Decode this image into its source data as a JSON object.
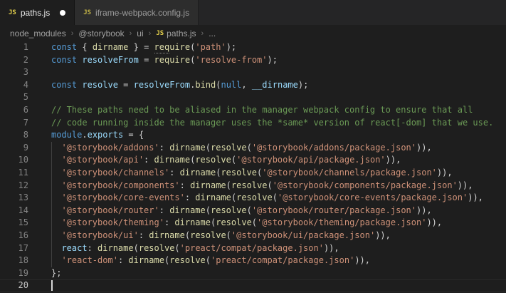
{
  "icons": {
    "js_badge": "JS",
    "modified_dot": "modified-dot"
  },
  "colors": {
    "editor_bg": "#1e1e1e",
    "tabstrip_bg": "#252526",
    "inactive_tab_bg": "#2d2d2d",
    "keyword": "#569cd6",
    "variable": "#9cdcfe",
    "function": "#dcdcaa",
    "string": "#ce9178",
    "comment": "#6a9955",
    "punctuation": "#d4d4d4",
    "js_icon": "#e8d44d",
    "line_number": "#858585"
  },
  "tabs": [
    {
      "label": "paths.js",
      "active": true,
      "modified": true
    },
    {
      "label": "iframe-webpack.config.js",
      "active": false,
      "modified": false
    }
  ],
  "breadcrumb": {
    "separator": "›",
    "items": [
      {
        "label": "node_modules",
        "icon": false
      },
      {
        "label": "@storybook",
        "icon": false
      },
      {
        "label": "ui",
        "icon": false
      },
      {
        "label": "paths.js",
        "icon": true
      },
      {
        "label": "...",
        "icon": false
      }
    ]
  },
  "editor": {
    "cursor_line": 20,
    "lines": [
      {
        "n": 1,
        "guide": false,
        "tokens": [
          [
            "kw",
            "const"
          ],
          [
            "pun",
            " { "
          ],
          [
            "fn",
            "dirname"
          ],
          [
            "pun",
            " } = "
          ],
          [
            "fnh",
            "req"
          ],
          [
            "fn",
            "uire"
          ],
          [
            "pun",
            "("
          ],
          [
            "str",
            "'path'"
          ],
          [
            "pun",
            ");"
          ]
        ]
      },
      {
        "n": 2,
        "guide": false,
        "tokens": [
          [
            "kw",
            "const"
          ],
          [
            "pun",
            " "
          ],
          [
            "var",
            "resolveFrom"
          ],
          [
            "pun",
            " = "
          ],
          [
            "fn",
            "require"
          ],
          [
            "pun",
            "("
          ],
          [
            "str",
            "'resolve-from'"
          ],
          [
            "pun",
            ");"
          ]
        ]
      },
      {
        "n": 3,
        "guide": false,
        "tokens": []
      },
      {
        "n": 4,
        "guide": false,
        "tokens": [
          [
            "kw",
            "const"
          ],
          [
            "pun",
            " "
          ],
          [
            "var",
            "resolve"
          ],
          [
            "pun",
            " = "
          ],
          [
            "var",
            "resolveFrom"
          ],
          [
            "pun",
            "."
          ],
          [
            "fn",
            "bind"
          ],
          [
            "pun",
            "("
          ],
          [
            "kw",
            "null"
          ],
          [
            "pun",
            ", "
          ],
          [
            "var",
            "__dirname"
          ],
          [
            "pun",
            ");"
          ]
        ]
      },
      {
        "n": 5,
        "guide": false,
        "tokens": []
      },
      {
        "n": 6,
        "guide": false,
        "tokens": [
          [
            "cmt",
            "// These paths need to be aliased in the manager webpack config to ensure that all"
          ]
        ]
      },
      {
        "n": 7,
        "guide": false,
        "tokens": [
          [
            "cmt",
            "// code running inside the manager uses the *same* version of react[-dom] that we use."
          ]
        ]
      },
      {
        "n": 8,
        "guide": false,
        "tokens": [
          [
            "kw",
            "module"
          ],
          [
            "pun",
            "."
          ],
          [
            "var",
            "exports"
          ],
          [
            "pun",
            " = {"
          ]
        ]
      },
      {
        "n": 9,
        "guide": true,
        "tokens": [
          [
            "pun",
            "  "
          ],
          [
            "str",
            "'@storybook/addons'"
          ],
          [
            "pun",
            ": "
          ],
          [
            "fn",
            "dirname"
          ],
          [
            "pun",
            "("
          ],
          [
            "fn",
            "resolve"
          ],
          [
            "pun",
            "("
          ],
          [
            "str",
            "'@storybook/addons/package.json'"
          ],
          [
            "pun",
            ")),"
          ]
        ]
      },
      {
        "n": 10,
        "guide": true,
        "tokens": [
          [
            "pun",
            "  "
          ],
          [
            "str",
            "'@storybook/api'"
          ],
          [
            "pun",
            ": "
          ],
          [
            "fn",
            "dirname"
          ],
          [
            "pun",
            "("
          ],
          [
            "fn",
            "resolve"
          ],
          [
            "pun",
            "("
          ],
          [
            "str",
            "'@storybook/api/package.json'"
          ],
          [
            "pun",
            ")),"
          ]
        ]
      },
      {
        "n": 11,
        "guide": true,
        "tokens": [
          [
            "pun",
            "  "
          ],
          [
            "str",
            "'@storybook/channels'"
          ],
          [
            "pun",
            ": "
          ],
          [
            "fn",
            "dirname"
          ],
          [
            "pun",
            "("
          ],
          [
            "fn",
            "resolve"
          ],
          [
            "pun",
            "("
          ],
          [
            "str",
            "'@storybook/channels/package.json'"
          ],
          [
            "pun",
            ")),"
          ]
        ]
      },
      {
        "n": 12,
        "guide": true,
        "tokens": [
          [
            "pun",
            "  "
          ],
          [
            "str",
            "'@storybook/components'"
          ],
          [
            "pun",
            ": "
          ],
          [
            "fn",
            "dirname"
          ],
          [
            "pun",
            "("
          ],
          [
            "fn",
            "resolve"
          ],
          [
            "pun",
            "("
          ],
          [
            "str",
            "'@storybook/components/package.json'"
          ],
          [
            "pun",
            ")),"
          ]
        ]
      },
      {
        "n": 13,
        "guide": true,
        "tokens": [
          [
            "pun",
            "  "
          ],
          [
            "str",
            "'@storybook/core-events'"
          ],
          [
            "pun",
            ": "
          ],
          [
            "fn",
            "dirname"
          ],
          [
            "pun",
            "("
          ],
          [
            "fn",
            "resolve"
          ],
          [
            "pun",
            "("
          ],
          [
            "str",
            "'@storybook/core-events/package.json'"
          ],
          [
            "pun",
            ")),"
          ]
        ]
      },
      {
        "n": 14,
        "guide": true,
        "tokens": [
          [
            "pun",
            "  "
          ],
          [
            "str",
            "'@storybook/router'"
          ],
          [
            "pun",
            ": "
          ],
          [
            "fn",
            "dirname"
          ],
          [
            "pun",
            "("
          ],
          [
            "fn",
            "resolve"
          ],
          [
            "pun",
            "("
          ],
          [
            "str",
            "'@storybook/router/package.json'"
          ],
          [
            "pun",
            ")),"
          ]
        ]
      },
      {
        "n": 15,
        "guide": true,
        "tokens": [
          [
            "pun",
            "  "
          ],
          [
            "str",
            "'@storybook/theming'"
          ],
          [
            "pun",
            ": "
          ],
          [
            "fn",
            "dirname"
          ],
          [
            "pun",
            "("
          ],
          [
            "fn",
            "resolve"
          ],
          [
            "pun",
            "("
          ],
          [
            "str",
            "'@storybook/theming/package.json'"
          ],
          [
            "pun",
            ")),"
          ]
        ]
      },
      {
        "n": 16,
        "guide": true,
        "tokens": [
          [
            "pun",
            "  "
          ],
          [
            "str",
            "'@storybook/ui'"
          ],
          [
            "pun",
            ": "
          ],
          [
            "fn",
            "dirname"
          ],
          [
            "pun",
            "("
          ],
          [
            "fn",
            "resolve"
          ],
          [
            "pun",
            "("
          ],
          [
            "str",
            "'@storybook/ui/package.json'"
          ],
          [
            "pun",
            ")),"
          ]
        ]
      },
      {
        "n": 17,
        "guide": true,
        "tokens": [
          [
            "pun",
            "  "
          ],
          [
            "var",
            "react"
          ],
          [
            "pun",
            ": "
          ],
          [
            "fn",
            "dirname"
          ],
          [
            "pun",
            "("
          ],
          [
            "fn",
            "resolve"
          ],
          [
            "pun",
            "("
          ],
          [
            "str",
            "'preact/compat/package.json'"
          ],
          [
            "pun",
            ")),"
          ]
        ]
      },
      {
        "n": 18,
        "guide": true,
        "tokens": [
          [
            "pun",
            "  "
          ],
          [
            "str",
            "'react-dom'"
          ],
          [
            "pun",
            ": "
          ],
          [
            "fn",
            "dirname"
          ],
          [
            "pun",
            "("
          ],
          [
            "fn",
            "resolve"
          ],
          [
            "pun",
            "("
          ],
          [
            "str",
            "'preact/compat/package.json'"
          ],
          [
            "pun",
            ")),"
          ]
        ]
      },
      {
        "n": 19,
        "guide": false,
        "tokens": [
          [
            "pun",
            "};"
          ]
        ]
      },
      {
        "n": 20,
        "guide": false,
        "tokens": []
      }
    ]
  }
}
